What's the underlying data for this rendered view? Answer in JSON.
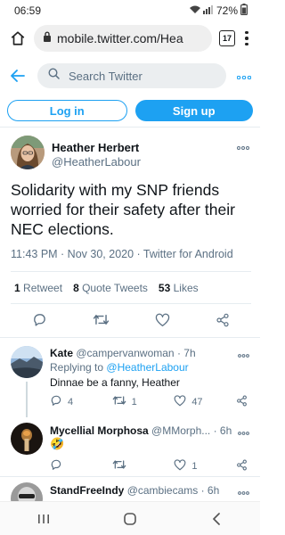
{
  "status_bar": {
    "time": "06:59",
    "battery": "72%"
  },
  "browser": {
    "url": "mobile.twitter.com/Hea",
    "tab_count": "17"
  },
  "header": {
    "search_placeholder": "Search Twitter"
  },
  "auth": {
    "login_label": "Log in",
    "signup_label": "Sign up"
  },
  "main_tweet": {
    "author_name": "Heather Herbert",
    "author_handle": "@HeatherLabour",
    "text": "Solidarity with my SNP friends worried for their safety after their NEC elections.",
    "meta": "11:43 PM · Nov 30, 2020 · Twitter for Android",
    "retweets_count": "1",
    "retweets_label": "Retweet",
    "quotes_count": "8",
    "quotes_label": "Quote Tweets",
    "likes_count": "53",
    "likes_label": "Likes"
  },
  "replies": [
    {
      "name": "Kate",
      "handle": "@campervanwoman",
      "time": "· 7h",
      "replying_prefix": "Replying to",
      "replying_to": "@HeatherLabour",
      "text": "Dinnae be a fanny, Heather",
      "reply_count": "4",
      "retweet_count": "1",
      "like_count": "47"
    },
    {
      "name": "Mycellial Morphosa",
      "handle": "@MMorph...",
      "time": "· 6h",
      "text": "🤣",
      "reply_count": "",
      "retweet_count": "",
      "like_count": "1"
    },
    {
      "name": "StandFreeIndy",
      "handle": "@cambiecams",
      "time": "· 6h"
    }
  ],
  "colors": {
    "accent": "#1da1f2",
    "secondary_text": "#5b7083",
    "divider": "#e6ecf0"
  }
}
